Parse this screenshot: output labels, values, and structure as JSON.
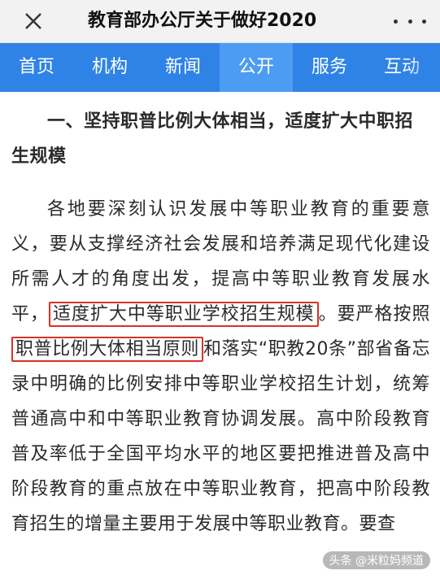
{
  "header": {
    "title": "教育部办公厅关于做好2020",
    "close_icon": "close-icon",
    "more_icon": "more-dots-icon"
  },
  "nav": {
    "items": [
      "首页",
      "机构",
      "新闻",
      "公开",
      "服务",
      "互动"
    ],
    "active_index": 3,
    "accent_color": "#2f83e6"
  },
  "article": {
    "heading": "一、坚持职普比例大体相当，适度扩大中职招生规模",
    "p_part1": "各地要深刻认识发展中等职业教育的重要意义，要从支撑经济社会发展和培养满足现代化建设所需人才的角度出发，提高中等职业教育发展水平，",
    "highlight1": "适度扩大中等职业学校招生规模",
    "p_part2": "。要严格按照",
    "highlight2": "职普比例大体相当原则",
    "p_part3": "和落实“职教20条”部省备忘录中明确的比例安排中等职业学校招生计划，统筹普通高中和中等职业教育协调发展。高中阶段教育普及率低于全国平均水平的地区要把推进普及高中阶段教育的重点放在中等职业教育，把高中阶段教育招生的增量主要用于发展中等职业教育。要查"
  },
  "watermark": {
    "text": "头条 @米粒妈频道"
  }
}
